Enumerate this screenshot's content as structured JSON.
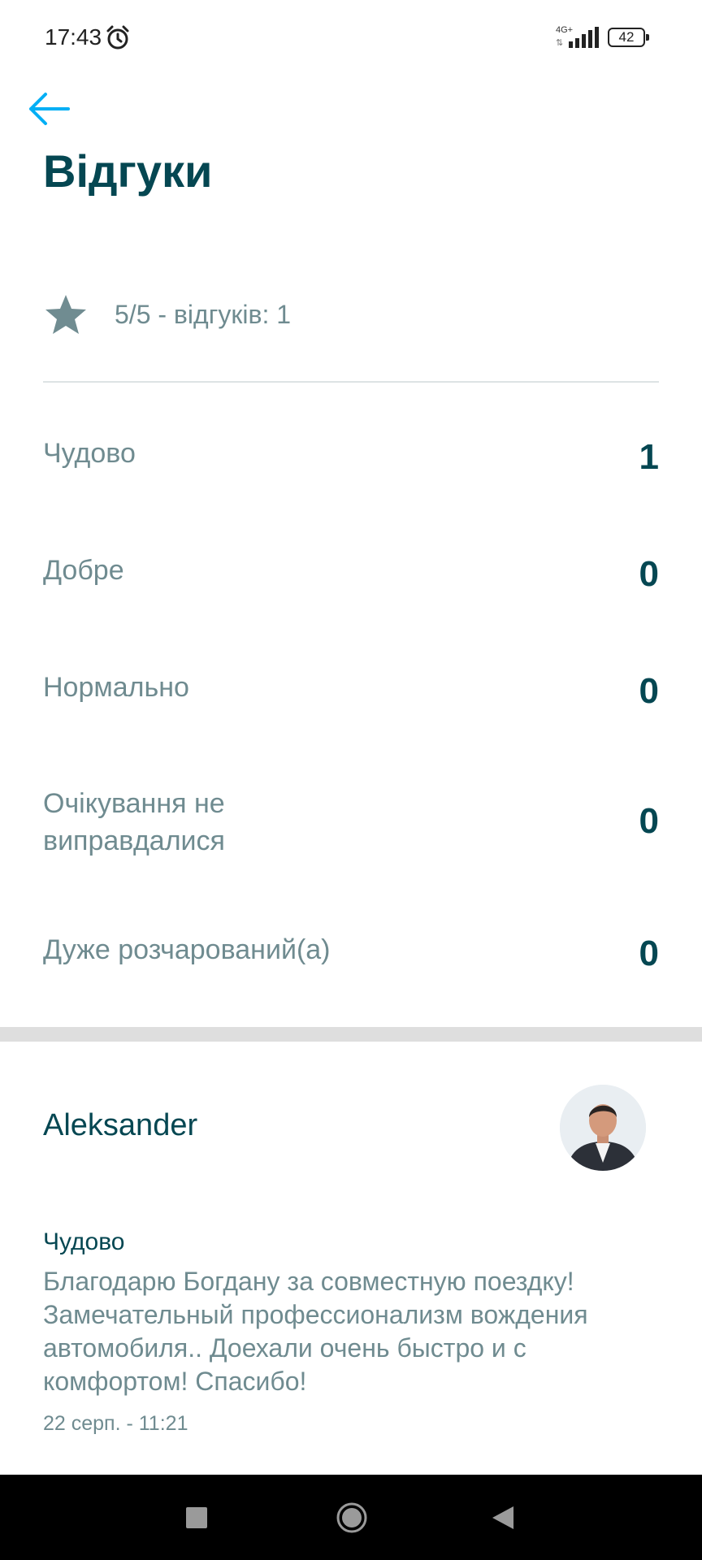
{
  "status_bar": {
    "time": "17:43",
    "network": "4G+",
    "battery": "42",
    "icons": [
      "alarm-icon",
      "signal-icon",
      "battery-icon"
    ]
  },
  "header": {
    "back_icon": "arrow-left-icon",
    "title": "Відгуки"
  },
  "summary": {
    "icon": "star-icon",
    "text": "5/5 - відгуків: 1"
  },
  "ratings": [
    {
      "label": "Чудово",
      "count": "1"
    },
    {
      "label": "Добре",
      "count": "0"
    },
    {
      "label": "Нормально",
      "count": "0"
    },
    {
      "label": "Очікування не виправдалися",
      "count": "0"
    },
    {
      "label": "Дуже розчарований(а)",
      "count": "0"
    }
  ],
  "review": {
    "author": "Aleksander",
    "rating": "Чудово",
    "text": "Благодарю Богдану за совместную поездку! Замечательный профессионализм вождения автомобиля.. Доехали очень быстро и с комфортом! Спасибо!",
    "date": "22 серп. - 11:21"
  },
  "nav_bar": {
    "icons": [
      "recent-apps-icon",
      "home-icon",
      "back-icon"
    ]
  },
  "colors": {
    "primary_text": "#054752",
    "secondary_text": "#6f8b90",
    "accent": "#00aff5",
    "star": "#708c91"
  }
}
